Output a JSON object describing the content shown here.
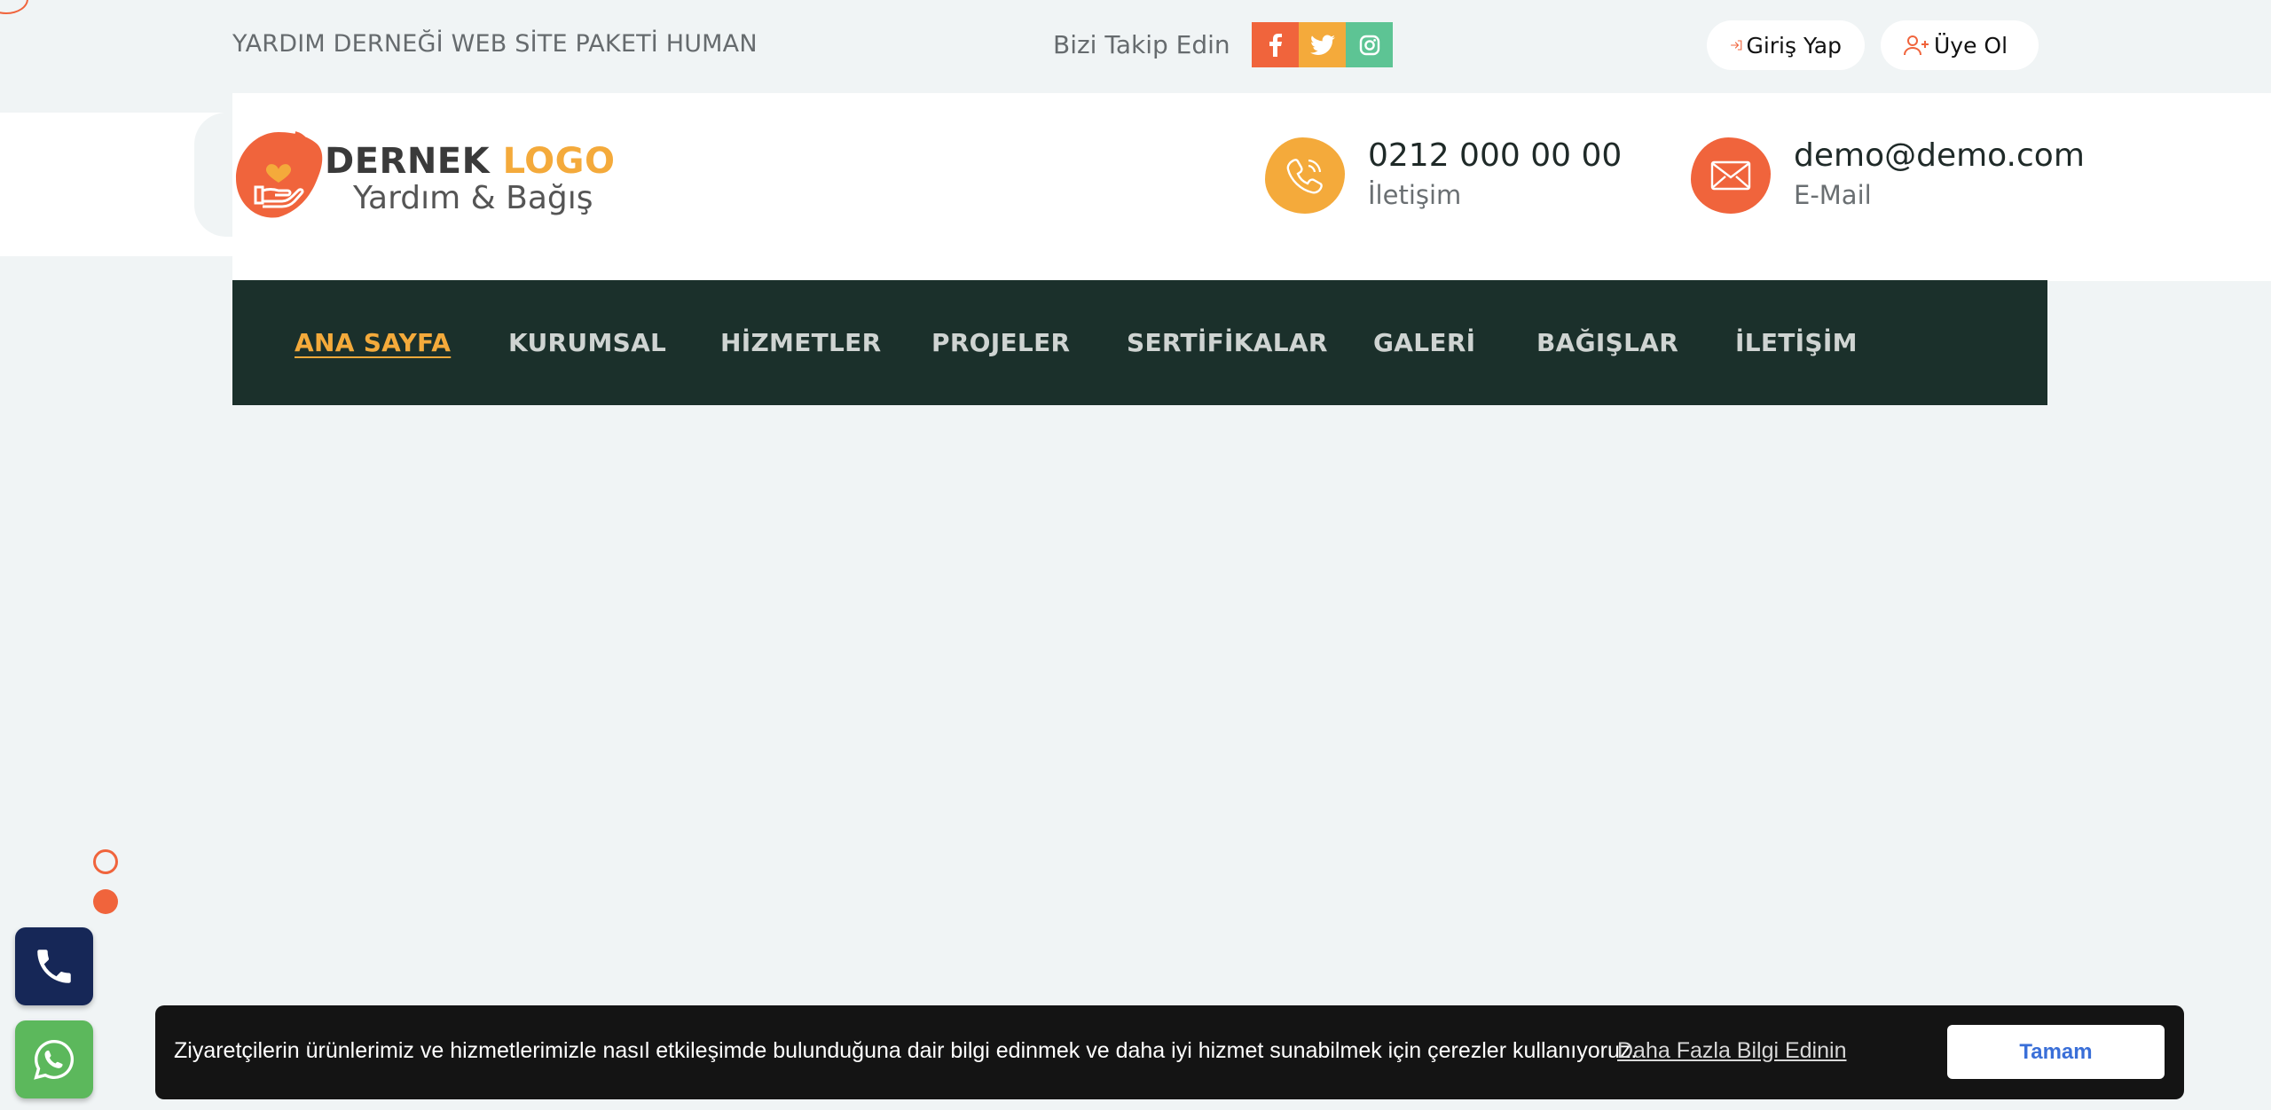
{
  "topbar": {
    "site_title": "YARDIM DERNEĞİ WEB SİTE PAKETİ HUMAN",
    "follow_label": "Bizi Takip Edin",
    "socials": [
      {
        "icon": "facebook-icon",
        "color": "#f0643c"
      },
      {
        "icon": "twitter-icon",
        "color": "#f4aa3b"
      },
      {
        "icon": "instagram-icon",
        "color": "#5dc494"
      }
    ],
    "login_label": "Giriş Yap",
    "register_label": "Üye Ol"
  },
  "header": {
    "logo_word1": "DERNEK",
    "logo_word2": "LOGO",
    "logo_tagline": "Yardım & Bağış",
    "phone": {
      "value": "0212 000 00 00",
      "label": "İletişim"
    },
    "email": {
      "value": "demo@demo.com",
      "label": "E-Mail"
    }
  },
  "nav": {
    "items": [
      {
        "label": "ANA SAYFA",
        "active": true
      },
      {
        "label": "KURUMSAL"
      },
      {
        "label": "HİZMETLER"
      },
      {
        "label": "PROJELER"
      },
      {
        "label": "SERTİFİKALAR"
      },
      {
        "label": "GALERİ"
      },
      {
        "label": "BAĞIŞLAR"
      },
      {
        "label": "İLETİŞİM"
      }
    ]
  },
  "cookie": {
    "message": "Ziyaretçilerin ürünlerimiz ve hizmetlerimizle nasıl etkileşimde bulunduğuna dair bilgi edinmek ve daha iyi hizmet sunabilmek için çerezler kullanıyoruz.",
    "link_label": "Daha Fazla Bilgi Edinin",
    "accept_label": "Tamam"
  },
  "colors": {
    "accent_orange": "#f0643c",
    "accent_yellow": "#f4aa3b",
    "nav_bg": "#1b302b",
    "page_bg": "#f0f4f5"
  }
}
